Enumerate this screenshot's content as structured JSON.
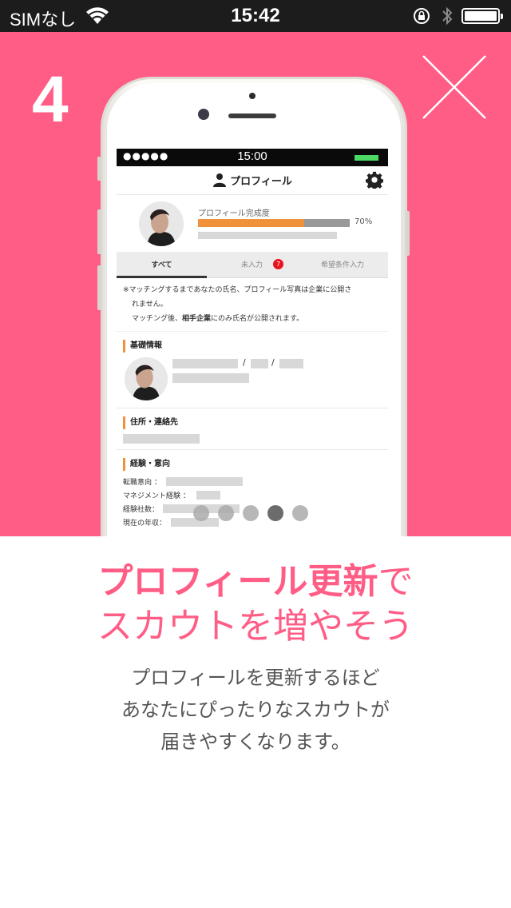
{
  "status_bar": {
    "carrier": "SIMなし",
    "time": "15:42",
    "battery_level": 1.0
  },
  "hero": {
    "step_number": "4",
    "background_color": "#ff5d86",
    "close_icon": "close-icon"
  },
  "phone_screen": {
    "status": {
      "signal_dots": "●●●●●",
      "time": "15:00"
    },
    "header": {
      "title": "プロフィール",
      "user_icon": "person-icon",
      "settings_icon": "gear-icon"
    },
    "completion": {
      "label": "プロフィール完成度",
      "percent_text": "70%",
      "percent": 70,
      "fill_color": "#f0923c"
    },
    "tabs": [
      {
        "label": "すべて",
        "active": true
      },
      {
        "label": "未入力",
        "badge": "7"
      },
      {
        "label": "希望条件入力"
      }
    ],
    "notice": {
      "line1": "※マッチングするまであなたの氏名、プロフィール写真は企業に公開さ",
      "line2": "れません。",
      "line3_prefix": "マッチング後、",
      "line3_bold": "相手企業",
      "line3_suffix": "にのみ氏名が公開されます。"
    },
    "sections": {
      "basic": {
        "title": "基礎情報",
        "slash": "/"
      },
      "address": {
        "title": "住所・連絡先"
      },
      "experience": {
        "title": "経験・意向",
        "fields": [
          "転職意向 ：",
          "マネジメント経験 ：",
          "経験社数：",
          "現在の年収："
        ]
      }
    }
  },
  "pager": {
    "count": 5,
    "active_index": 3
  },
  "headline": {
    "line1_bold": "プロフィール更新",
    "line1_normal": "で",
    "line2": "スカウトを増やそう"
  },
  "description": {
    "line1": "プロフィールを更新するほど",
    "line2": "あなたにぴったりなスカウトが",
    "line3": "届きやすくなります。"
  }
}
